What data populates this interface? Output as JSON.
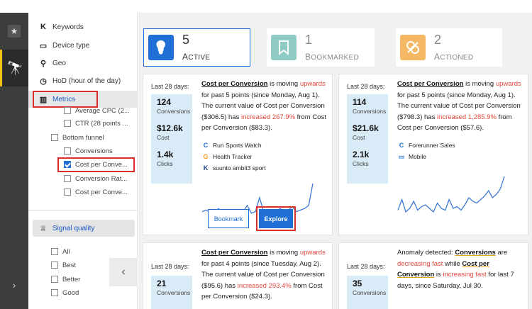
{
  "sidebar": {
    "items": [
      {
        "icon": "keyword-k-icon",
        "glyph": "K",
        "label": "Keywords"
      },
      {
        "icon": "device-icon",
        "glyph": "▭",
        "label": "Device type"
      },
      {
        "icon": "location-pin-icon",
        "glyph": "⚲",
        "label": "Geo"
      },
      {
        "icon": "clock-icon",
        "glyph": "◷",
        "label": "HoD (hour of the day)"
      },
      {
        "icon": "bar-chart-icon",
        "glyph": "▥",
        "label": "Metrics"
      }
    ],
    "metrics_options": [
      {
        "label": "Average CPC (2...",
        "checked": false
      },
      {
        "label": "CTR (28 points ...",
        "checked": false
      }
    ],
    "bottom_funnel": {
      "label": "Bottom funnel",
      "checked": false
    },
    "funnel_options": [
      {
        "label": "Conversions",
        "checked": false
      },
      {
        "label": "Cost per Conve...",
        "checked": true
      },
      {
        "label": "Conversion Rat...",
        "checked": false
      },
      {
        "label": "Cost per Conve...",
        "checked": false
      }
    ],
    "signal_quality": {
      "icon": "trophy-icon",
      "glyph": "♕",
      "label": "Signal quality"
    },
    "quality_options": [
      {
        "label": "All",
        "checked": false
      },
      {
        "label": "Best",
        "checked": false
      },
      {
        "label": "Better",
        "checked": false
      },
      {
        "label": "Good",
        "checked": false
      }
    ],
    "collapse_glyph": "‹"
  },
  "rail": {
    "star_glyph": "★",
    "scope_glyph": "🔭",
    "expand_glyph": "›"
  },
  "summary": [
    {
      "count": "5",
      "label_first": "A",
      "label_rest": "CTIVE",
      "color": "#1f6fd6",
      "icon": "lightbulb-icon",
      "glyph": "💡"
    },
    {
      "count": "1",
      "label_first": "B",
      "label_rest": "OOKMARKED",
      "color": "#7fc4bd",
      "icon": "bookmark-icon",
      "glyph": "🔖"
    },
    {
      "count": "2",
      "label_first": "A",
      "label_rest": "CTIONED",
      "color": "#f2b25c",
      "icon": "actioned-icon",
      "glyph": "✥"
    }
  ],
  "cards": [
    {
      "last28": "Last 28 days:",
      "stats": [
        {
          "value": "124",
          "unit": "Conversions"
        },
        {
          "value": "$12.6k",
          "unit": "Cost"
        },
        {
          "value": "1.4k",
          "unit": "Clicks"
        }
      ],
      "metric": "Cost per Conversion",
      "moving": " is moving ",
      "direction": "upwards",
      "period": " for past 5 points (since Monday, Aug 1). The current value of Cost per Conversion ($306.5) has ",
      "change": "increased 267.9%",
      "from": " from Cost per Conversion ($83.3).",
      "sources": [
        {
          "glyph": "C",
          "color": "#1f6fd6",
          "label": "Run Sports Watch",
          "icon": "campaign-icon"
        },
        {
          "glyph": "G",
          "color": "#f59b1d",
          "label": "Health Tracker",
          "icon": "adgroup-icon"
        },
        {
          "glyph": "K",
          "color": "#1a3d8f",
          "label": "suunto ambit3 sport",
          "icon": "keyword-icon"
        }
      ],
      "spark": [
        4,
        5,
        3,
        4,
        6,
        3,
        2,
        5,
        4,
        3,
        4,
        8,
        3,
        4,
        13,
        4,
        5,
        3,
        4,
        6,
        4,
        5,
        7,
        4,
        5,
        6,
        8,
        22
      ],
      "bookmark": "Bookmark",
      "explore": "Explore"
    },
    {
      "last28": "Last 28 days:",
      "stats": [
        {
          "value": "114",
          "unit": "Conversions"
        },
        {
          "value": "$21.6k",
          "unit": "Cost"
        },
        {
          "value": "2.1k",
          "unit": "Clicks"
        }
      ],
      "metric": "Cost per Conversion",
      "moving": " is moving ",
      "direction": "upwards",
      "period": " for past 5 points (since Monday, Aug 1). The current value of Cost per Conversion ($798.3) has ",
      "change": "increased 1,285.9%",
      "from": " from Cost per Conversion ($57.6).",
      "sources": [
        {
          "glyph": "C",
          "color": "#1f6fd6",
          "label": "Forerunner Sales",
          "icon": "campaign-icon"
        },
        {
          "glyph": "▭",
          "color": "#1f6fd6",
          "label": "Mobile",
          "icon": "device-icon"
        }
      ],
      "spark": [
        3,
        9,
        2,
        4,
        8,
        3,
        5,
        6,
        4,
        2,
        7,
        4,
        3,
        9,
        4,
        5,
        3,
        6,
        10,
        8,
        7,
        9,
        11,
        14,
        10,
        12,
        15,
        22
      ]
    },
    {
      "last28": "Last 28 days:",
      "stats": [
        {
          "value": "21",
          "unit": "Conversions"
        }
      ],
      "metric": "Cost per Conversion",
      "moving": " is moving ",
      "direction": "upwards",
      "period": " for past 4 points (since Tuesday, Aug 2). The current value of Cost per Conversion ($95.6) has ",
      "change": "increased 293.4%",
      "from": " from Cost per Conversion ($24.3)."
    },
    {
      "last28": "Last 28 days:",
      "stats": [
        {
          "value": "35",
          "unit": "Conversions"
        }
      ],
      "anomaly": "Anomaly detected: ",
      "metric_a": "Conversions",
      "are": " are ",
      "dec": "decreasing fast",
      "while": " while ",
      "metric_b": "Cost per Conversion",
      "is": " is ",
      "inc": "increasing fast",
      "rest": " for last 7 days, since Saturday, Jul 30."
    }
  ]
}
